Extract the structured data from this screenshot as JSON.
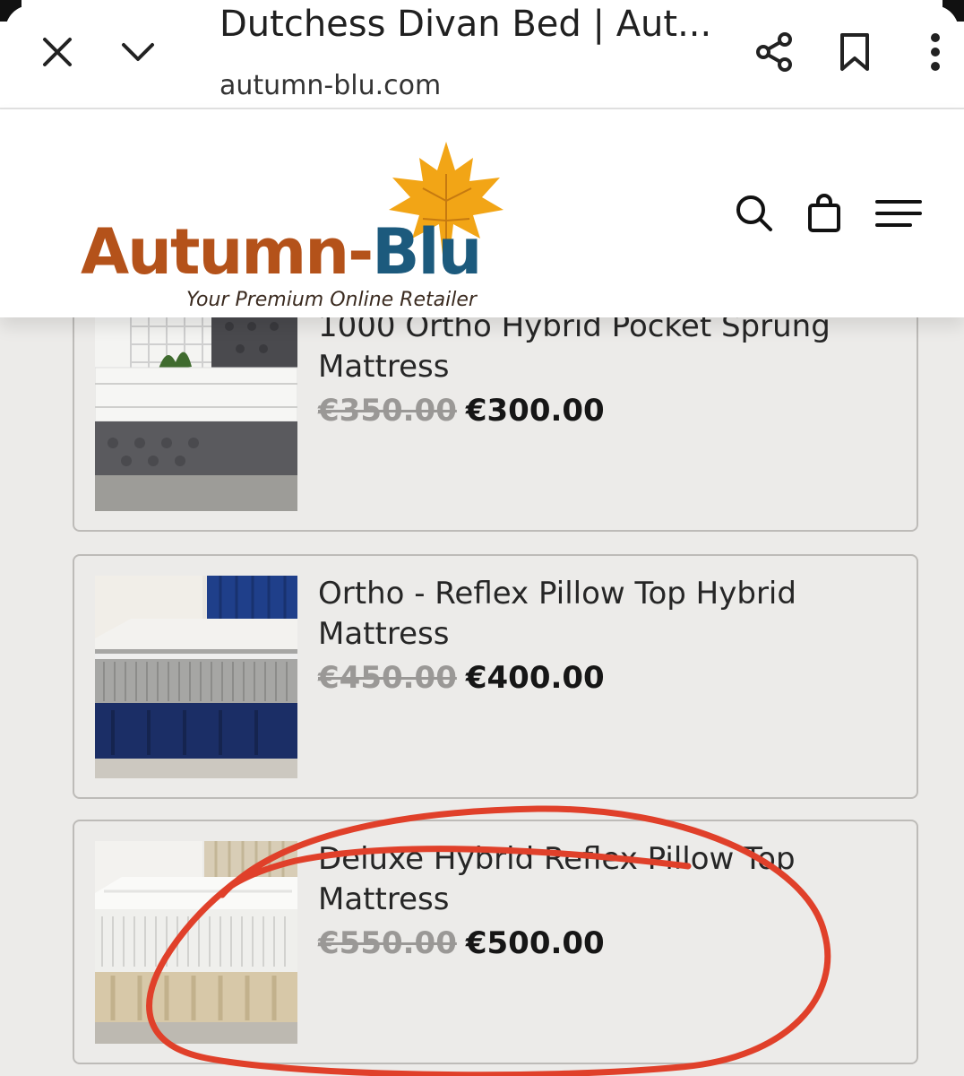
{
  "browser": {
    "title": "Dutchess Divan Bed | Aut...",
    "url": "autumn-blu.com",
    "icons": [
      "close-icon",
      "chevron-down-icon",
      "share-icon",
      "bookmark-icon",
      "more-vert-icon"
    ]
  },
  "site": {
    "logo_primary": "Autumn-",
    "logo_secondary": "Blu",
    "tagline": "Your Premium Online Retailer",
    "icons": [
      "search-icon",
      "shopping-bag-icon",
      "menu-icon"
    ]
  },
  "products": [
    {
      "name": "1000 Ortho Hybrid Pocket Sprung Mattress",
      "old_price": "€350.00",
      "price": "€300.00"
    },
    {
      "name": "Ortho - Reflex Pillow Top Hybrid Mattress",
      "old_price": "€450.00",
      "price": "€400.00"
    },
    {
      "name": "Deluxe Hybrid Reflex Pillow Top Mattress",
      "old_price": "€550.00",
      "price": "€500.00"
    }
  ],
  "colors": {
    "annotation": "#e0402a",
    "logo_autumn": "#b4521a",
    "logo_blu": "#1c5a7d",
    "leaf": "#f2a516"
  }
}
